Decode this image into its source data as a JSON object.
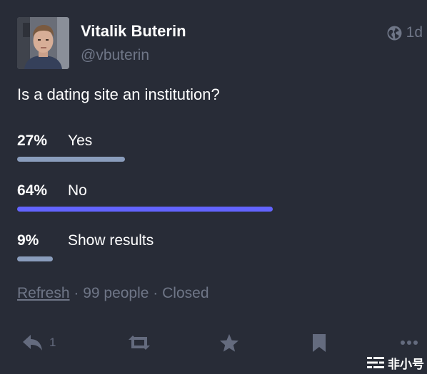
{
  "status": {
    "author": {
      "display_name": "Vitalik Buterin",
      "handle": "@vbuterin",
      "avatar_icon": "profile-photo"
    },
    "visibility_icon": "globe-icon",
    "relative_time": "1d",
    "content": "Is a dating site an institution?",
    "poll": {
      "options": [
        {
          "percent_label": "27%",
          "label": "Yes",
          "fraction": 0.27,
          "leading": false
        },
        {
          "percent_label": "64%",
          "label": "No",
          "fraction": 0.64,
          "leading": true
        },
        {
          "percent_label": "9%",
          "label": "Show results",
          "fraction": 0.09,
          "leading": false
        }
      ],
      "footer": {
        "refresh_label": "Refresh",
        "separator": " · ",
        "voters": "99 people",
        "state": "Closed"
      }
    },
    "actions": {
      "reply_icon": "reply-icon",
      "reply_count": "1",
      "boost_icon": "retweet-icon",
      "favourite_icon": "star-icon",
      "bookmark_icon": "bookmark-icon",
      "more_icon": "ellipsis-icon"
    }
  },
  "watermark": {
    "text": "非小号"
  },
  "colors": {
    "background": "#282c37",
    "text": "#ffffff",
    "muted": "#6f7687",
    "bar": "#8a9dbc",
    "bar_leading": "#6364ff",
    "icon": "#646b7e"
  }
}
